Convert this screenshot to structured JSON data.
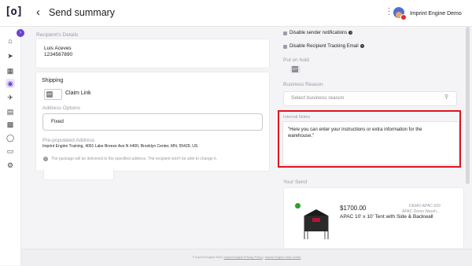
{
  "app": {
    "logo": "[o]",
    "page_title": "Send summary",
    "user_name": "Imprint Engine Demo"
  },
  "recipient": {
    "section_label": "Recipient's Details",
    "name": "Luis Aceves",
    "phone": "1234567890"
  },
  "shipping": {
    "title": "Shipping",
    "toggle_text": "OFF",
    "claim_link_label": "Claim Link",
    "address_options_label": "Address Options",
    "address_option_value": "Fixed",
    "prepopulated_label": "Pre-populated Address",
    "address": "Imprint Engine Training, 4001 Lake Breeze Ave N #400, Brooklyn Center, MN, 55429, US",
    "info_note": "The package will be delivered to the specified address. The recipient won't be able to change it."
  },
  "options": {
    "disable_notifications": "Disable sender notifications",
    "disable_tracking": "Disable Recipient Tracking Email",
    "put_on_hold_label": "Put on hold",
    "hold_toggle_text": "OFF",
    "business_reason_label": "Business Reason",
    "business_reason_placeholder": "Select business reason"
  },
  "notes": {
    "label": "Internal Notes",
    "text": "\"Here you can enter your instructions or extra information for the warehouse.\""
  },
  "your_send": {
    "label": "Your Send",
    "price": "$1700.00",
    "sku": "DEMO-APAC-029",
    "sku_sub": "APAC Demo Wareh...",
    "product": "APAC 10' x 10' Tent with Side & Backwall"
  },
  "footer": {
    "copyright": "© Imprint Engine 2025.",
    "privacy": "Imprint Engine Privacy Policy",
    "separator": "|",
    "help": "Imprint Engine Help Center"
  },
  "colors": {
    "accent": "#6b3fd6",
    "highlight": "#e0131f",
    "badge": "#d9302b"
  },
  "icons": [
    "home-icon",
    "send-icon",
    "inventory-icon",
    "campaign-icon",
    "automation-icon",
    "orders-icon",
    "catalog-icon",
    "integrations-icon",
    "folders-icon",
    "settings-icon"
  ]
}
